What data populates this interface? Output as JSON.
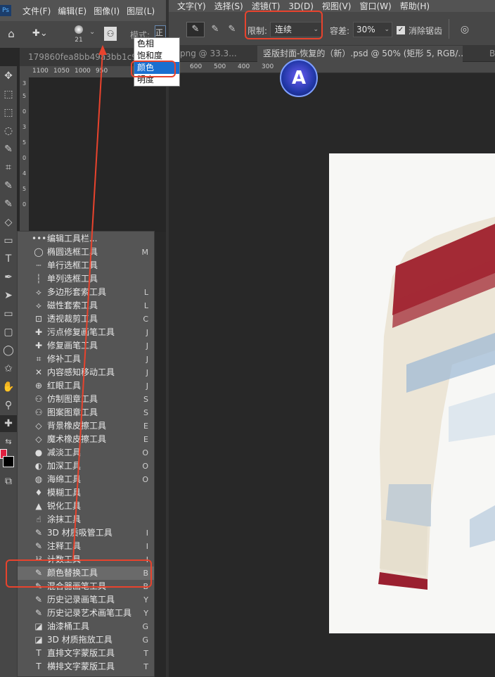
{
  "left_window": {
    "menu": [
      "文件(F)",
      "编辑(E)",
      "图像(I)",
      "图层(L)"
    ],
    "options": {
      "brush_size": "21",
      "mode_label": "模式:",
      "mode_value": "正"
    },
    "doc_tab": "179860fea8bb49a3bb1c99",
    "ruler_ticks": [
      "1100",
      "1050",
      "1000",
      "950"
    ],
    "vruler_ticks": [
      "3",
      "5",
      "0",
      "3",
      "5",
      "0",
      "4",
      "5",
      "0",
      "4"
    ]
  },
  "mode_dropdown": {
    "items": [
      "色相",
      "饱和度",
      "颜色",
      "明度"
    ],
    "selected_index": 2
  },
  "right_window": {
    "menu": [
      "文字(Y)",
      "选择(S)",
      "滤镜(T)",
      "3D(D)",
      "视图(V)",
      "窗口(W)",
      "帮助(H)"
    ],
    "options": {
      "limit_label": "限制:",
      "limit_value": "连续",
      "tolerance_label": "容差:",
      "tolerance_value": "30%",
      "antialias_label": "消除锯齿",
      "antialias_checked": true
    },
    "tabs": [
      "png @ 33.3...",
      "竖版封面-恢复的（新）.psd @ 50% (矩形 5, RGB/...",
      "B"
    ],
    "ruler_ticks": [
      "600",
      "500",
      "400",
      "300",
      "200"
    ]
  },
  "flyout": {
    "items": [
      {
        "icon": "•••",
        "name": "编辑工具栏...",
        "shortcut": ""
      },
      {
        "icon": "◯",
        "name": "椭圆选框工具",
        "shortcut": "M"
      },
      {
        "icon": "┄",
        "name": "单行选框工具",
        "shortcut": ""
      },
      {
        "icon": "┆",
        "name": "单列选框工具",
        "shortcut": ""
      },
      {
        "icon": "⟡",
        "name": "多边形套索工具",
        "shortcut": "L"
      },
      {
        "icon": "⟡",
        "name": "磁性套索工具",
        "shortcut": "L"
      },
      {
        "icon": "⊡",
        "name": "透视裁剪工具",
        "shortcut": "C"
      },
      {
        "icon": "✚",
        "name": "污点修复画笔工具",
        "shortcut": "J"
      },
      {
        "icon": "✚",
        "name": "修复画笔工具",
        "shortcut": "J"
      },
      {
        "icon": "⌗",
        "name": "修补工具",
        "shortcut": "J"
      },
      {
        "icon": "✕",
        "name": "内容感知移动工具",
        "shortcut": "J"
      },
      {
        "icon": "⊕",
        "name": "红眼工具",
        "shortcut": "J"
      },
      {
        "icon": "⚇",
        "name": "仿制图章工具",
        "shortcut": "S"
      },
      {
        "icon": "⚇",
        "name": "图案图章工具",
        "shortcut": "S"
      },
      {
        "icon": "◇",
        "name": "背景橡皮擦工具",
        "shortcut": "E"
      },
      {
        "icon": "◇",
        "name": "魔术橡皮擦工具",
        "shortcut": "E"
      },
      {
        "icon": "●",
        "name": "减淡工具",
        "shortcut": "O"
      },
      {
        "icon": "◐",
        "name": "加深工具",
        "shortcut": "O"
      },
      {
        "icon": "◍",
        "name": "海绵工具",
        "shortcut": "O"
      },
      {
        "icon": "♦",
        "name": "模糊工具",
        "shortcut": ""
      },
      {
        "icon": "▲",
        "name": "锐化工具",
        "shortcut": ""
      },
      {
        "icon": "☝",
        "name": "涂抹工具",
        "shortcut": ""
      },
      {
        "icon": "✎",
        "name": "3D 材质吸管工具",
        "shortcut": "I"
      },
      {
        "icon": "✎",
        "name": "注释工具",
        "shortcut": "I"
      },
      {
        "icon": "¹²",
        "name": "计数工具",
        "shortcut": "I"
      },
      {
        "icon": "✎",
        "name": "颜色替换工具",
        "shortcut": "B"
      },
      {
        "icon": "✎",
        "name": "混合器画笔工具",
        "shortcut": "B"
      },
      {
        "icon": "✎",
        "name": "历史记录画笔工具",
        "shortcut": "Y"
      },
      {
        "icon": "✎",
        "name": "历史记录艺术画笔工具",
        "shortcut": "Y"
      },
      {
        "icon": "◪",
        "name": "油漆桶工具",
        "shortcut": "G"
      },
      {
        "icon": "◪",
        "name": "3D 材质拖放工具",
        "shortcut": "G"
      },
      {
        "icon": "T",
        "name": "直排文字蒙版工具",
        "shortcut": "T"
      },
      {
        "icon": "T",
        "name": "横排文字蒙版工具",
        "shortcut": "T"
      }
    ]
  },
  "colors": {
    "accent_red": "#e8432d",
    "foreground": "#e02040",
    "background": "#000000"
  }
}
